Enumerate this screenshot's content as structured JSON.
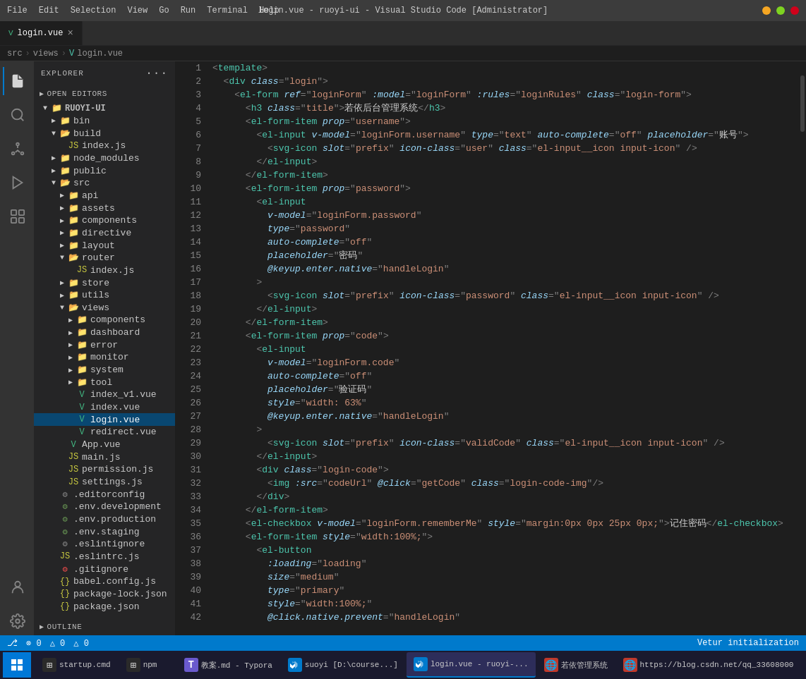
{
  "titleBar": {
    "title": "login.vue - ruoyi-ui - Visual Studio Code [Administrator]",
    "menu": [
      "File",
      "Edit",
      "Selection",
      "View",
      "Go",
      "Run",
      "Terminal",
      "Help"
    ]
  },
  "tabs": [
    {
      "id": "login",
      "label": "login.vue",
      "active": true,
      "icon": "vue"
    }
  ],
  "breadcrumb": [
    "src",
    "views",
    "login.vue"
  ],
  "sidebar": {
    "title": "EXPLORER",
    "openEditorsLabel": "OPEN EDITORS",
    "rootLabel": "RUOYI-UI",
    "tree": [
      {
        "indent": 1,
        "type": "folder",
        "label": "bin",
        "arrow": "▶",
        "open": false
      },
      {
        "indent": 1,
        "type": "folder",
        "label": "build",
        "arrow": "▶",
        "open": false
      },
      {
        "indent": 2,
        "type": "js",
        "label": "index.js"
      },
      {
        "indent": 1,
        "type": "folder",
        "label": "node_modules",
        "arrow": "▶",
        "open": false
      },
      {
        "indent": 1,
        "type": "folder",
        "label": "public",
        "arrow": "▶",
        "open": false
      },
      {
        "indent": 1,
        "type": "folder-open",
        "label": "src",
        "arrow": "▼",
        "open": true
      },
      {
        "indent": 2,
        "type": "folder",
        "label": "api",
        "arrow": "▶",
        "open": false
      },
      {
        "indent": 2,
        "type": "folder",
        "label": "assets",
        "arrow": "▶",
        "open": false
      },
      {
        "indent": 2,
        "type": "folder",
        "label": "components",
        "arrow": "▶",
        "open": false
      },
      {
        "indent": 2,
        "type": "folder",
        "label": "directive",
        "arrow": "▶",
        "open": false
      },
      {
        "indent": 2,
        "type": "folder",
        "label": "layout",
        "arrow": "▶",
        "open": false
      },
      {
        "indent": 2,
        "type": "folder-open",
        "label": "router",
        "arrow": "▼",
        "open": true
      },
      {
        "indent": 3,
        "type": "js",
        "label": "index.js"
      },
      {
        "indent": 2,
        "type": "folder",
        "label": "store",
        "arrow": "▶",
        "open": false
      },
      {
        "indent": 2,
        "type": "folder",
        "label": "utils",
        "arrow": "▶",
        "open": false
      },
      {
        "indent": 2,
        "type": "folder-open",
        "label": "views",
        "arrow": "▼",
        "open": true
      },
      {
        "indent": 3,
        "type": "folder",
        "label": "components",
        "arrow": "▶",
        "open": false
      },
      {
        "indent": 3,
        "type": "folder",
        "label": "dashboard",
        "arrow": "▶",
        "open": false
      },
      {
        "indent": 3,
        "type": "folder",
        "label": "error",
        "arrow": "▶",
        "open": false
      },
      {
        "indent": 3,
        "type": "folder",
        "label": "monitor",
        "arrow": "▶",
        "open": false
      },
      {
        "indent": 3,
        "type": "folder",
        "label": "system",
        "arrow": "▶",
        "open": false
      },
      {
        "indent": 3,
        "type": "folder",
        "label": "tool",
        "arrow": "▶",
        "open": false
      },
      {
        "indent": 3,
        "type": "vue",
        "label": "index_v1.vue"
      },
      {
        "indent": 3,
        "type": "vue",
        "label": "index.vue"
      },
      {
        "indent": 3,
        "type": "vue",
        "label": "login.vue",
        "active": true
      },
      {
        "indent": 3,
        "type": "vue",
        "label": "redirect.vue"
      },
      {
        "indent": 2,
        "type": "vue",
        "label": "App.vue"
      },
      {
        "indent": 2,
        "type": "js",
        "label": "main.js"
      },
      {
        "indent": 2,
        "type": "js",
        "label": "permission.js"
      },
      {
        "indent": 2,
        "type": "js",
        "label": "settings.js"
      },
      {
        "indent": 1,
        "type": "config",
        "label": ".editorconfig"
      },
      {
        "indent": 1,
        "type": "env",
        "label": ".env.development"
      },
      {
        "indent": 1,
        "type": "env",
        "label": ".env.production"
      },
      {
        "indent": 1,
        "type": "env",
        "label": ".env.staging"
      },
      {
        "indent": 1,
        "type": "config",
        "label": ".eslintignore"
      },
      {
        "indent": 1,
        "type": "js",
        "label": ".eslintrc.js"
      },
      {
        "indent": 1,
        "type": "git",
        "label": ".gitignore"
      },
      {
        "indent": 1,
        "type": "json",
        "label": "babel.config.js"
      },
      {
        "indent": 1,
        "type": "json",
        "label": "package-lock.json"
      },
      {
        "indent": 1,
        "type": "json",
        "label": "package.json"
      }
    ]
  },
  "editor": {
    "filename": "login.vue",
    "lines": [
      {
        "num": 1,
        "code": "<template>"
      },
      {
        "num": 2,
        "code": "  <div class=\"login\">"
      },
      {
        "num": 3,
        "code": "    <el-form ref=\"loginForm\" :model=\"loginForm\" :rules=\"loginRules\" class=\"login-form\">"
      },
      {
        "num": 4,
        "code": "      <h3 class=\"title\">若依后台管理系统</h3>"
      },
      {
        "num": 5,
        "code": "      <el-form-item prop=\"username\">"
      },
      {
        "num": 6,
        "code": "        <el-input v-model=\"loginForm.username\" type=\"text\" auto-complete=\"off\" placeholder=\"账号\">"
      },
      {
        "num": 7,
        "code": "          <svg-icon slot=\"prefix\" icon-class=\"user\" class=\"el-input__icon input-icon\" />"
      },
      {
        "num": 8,
        "code": "        </el-input>"
      },
      {
        "num": 9,
        "code": "      </el-form-item>"
      },
      {
        "num": 10,
        "code": "      <el-form-item prop=\"password\">"
      },
      {
        "num": 11,
        "code": "        <el-input"
      },
      {
        "num": 12,
        "code": "          v-model=\"loginForm.password\""
      },
      {
        "num": 13,
        "code": "          type=\"password\""
      },
      {
        "num": 14,
        "code": "          auto-complete=\"off\""
      },
      {
        "num": 15,
        "code": "          placeholder=\"密码\""
      },
      {
        "num": 16,
        "code": "          @keyup.enter.native=\"handleLogin\""
      },
      {
        "num": 17,
        "code": "        >"
      },
      {
        "num": 18,
        "code": "          <svg-icon slot=\"prefix\" icon-class=\"password\" class=\"el-input__icon input-icon\" />"
      },
      {
        "num": 19,
        "code": "        </el-input>"
      },
      {
        "num": 20,
        "code": "      </el-form-item>"
      },
      {
        "num": 21,
        "code": "      <el-form-item prop=\"code\">"
      },
      {
        "num": 22,
        "code": "        <el-input"
      },
      {
        "num": 23,
        "code": "          v-model=\"loginForm.code\""
      },
      {
        "num": 24,
        "code": "          auto-complete=\"off\""
      },
      {
        "num": 25,
        "code": "          placeholder=\"验证码\""
      },
      {
        "num": 26,
        "code": "          style=\"width: 63%\""
      },
      {
        "num": 27,
        "code": "          @keyup.enter.native=\"handleLogin\""
      },
      {
        "num": 28,
        "code": "        >"
      },
      {
        "num": 29,
        "code": "          <svg-icon slot=\"prefix\" icon-class=\"validCode\" class=\"el-input__icon input-icon\" />"
      },
      {
        "num": 30,
        "code": "        </el-input>"
      },
      {
        "num": 31,
        "code": "        <div class=\"login-code\">"
      },
      {
        "num": 32,
        "code": "          <img :src=\"codeUrl\" @click=\"getCode\" class=\"login-code-img\"/>"
      },
      {
        "num": 33,
        "code": "        </div>"
      },
      {
        "num": 34,
        "code": "      </el-form-item>"
      },
      {
        "num": 35,
        "code": "      <el-checkbox v-model=\"loginForm.rememberMe\" style=\"margin:0px 0px 25px 0px;\">记住密码</el-checkbox>"
      },
      {
        "num": 36,
        "code": "      <el-form-item style=\"width:100%;\">"
      },
      {
        "num": 37,
        "code": "        <el-button"
      },
      {
        "num": 38,
        "code": "          :loading=\"loading\""
      },
      {
        "num": 39,
        "code": "          size=\"medium\""
      },
      {
        "num": 40,
        "code": "          type=\"primary\""
      },
      {
        "num": 41,
        "code": "          style=\"width:100%;\""
      },
      {
        "num": 42,
        "code": "          @click.native.prevent=\"handleLogin\""
      }
    ]
  },
  "statusBar": {
    "left": [
      "⊗ 0",
      "⚠ 0",
      "△ 0"
    ],
    "vetur": "Vetur initialization",
    "encoding": "",
    "lineEnding": "",
    "language": ""
  },
  "taskbar": {
    "items": [
      {
        "label": "startup.cmd",
        "icon": "⊞",
        "iconBg": "#1a1a1a"
      },
      {
        "label": "npm",
        "icon": "⊞",
        "iconBg": "#1a1a1a"
      },
      {
        "label": "教案.md - Typora",
        "icon": "T",
        "iconBg": "#6a5acd"
      },
      {
        "label": "suoyi [D:\\course...]",
        "icon": "◈",
        "iconBg": "#007acc"
      },
      {
        "label": "login.vue - ruoyi-...",
        "icon": "◈",
        "iconBg": "#007acc",
        "active": true
      },
      {
        "label": "若依管理系统",
        "icon": "🌐",
        "iconBg": "#c0392b"
      },
      {
        "label": "https://blog.csdn.net/qq_33608000",
        "icon": "🌐",
        "iconBg": "#c0392b"
      }
    ]
  },
  "sidebarIcons": {
    "top": [
      "files",
      "search",
      "source-control",
      "debug",
      "extensions"
    ],
    "bottom": [
      "account",
      "settings"
    ]
  },
  "outline": {
    "label": "OUTLINE"
  }
}
